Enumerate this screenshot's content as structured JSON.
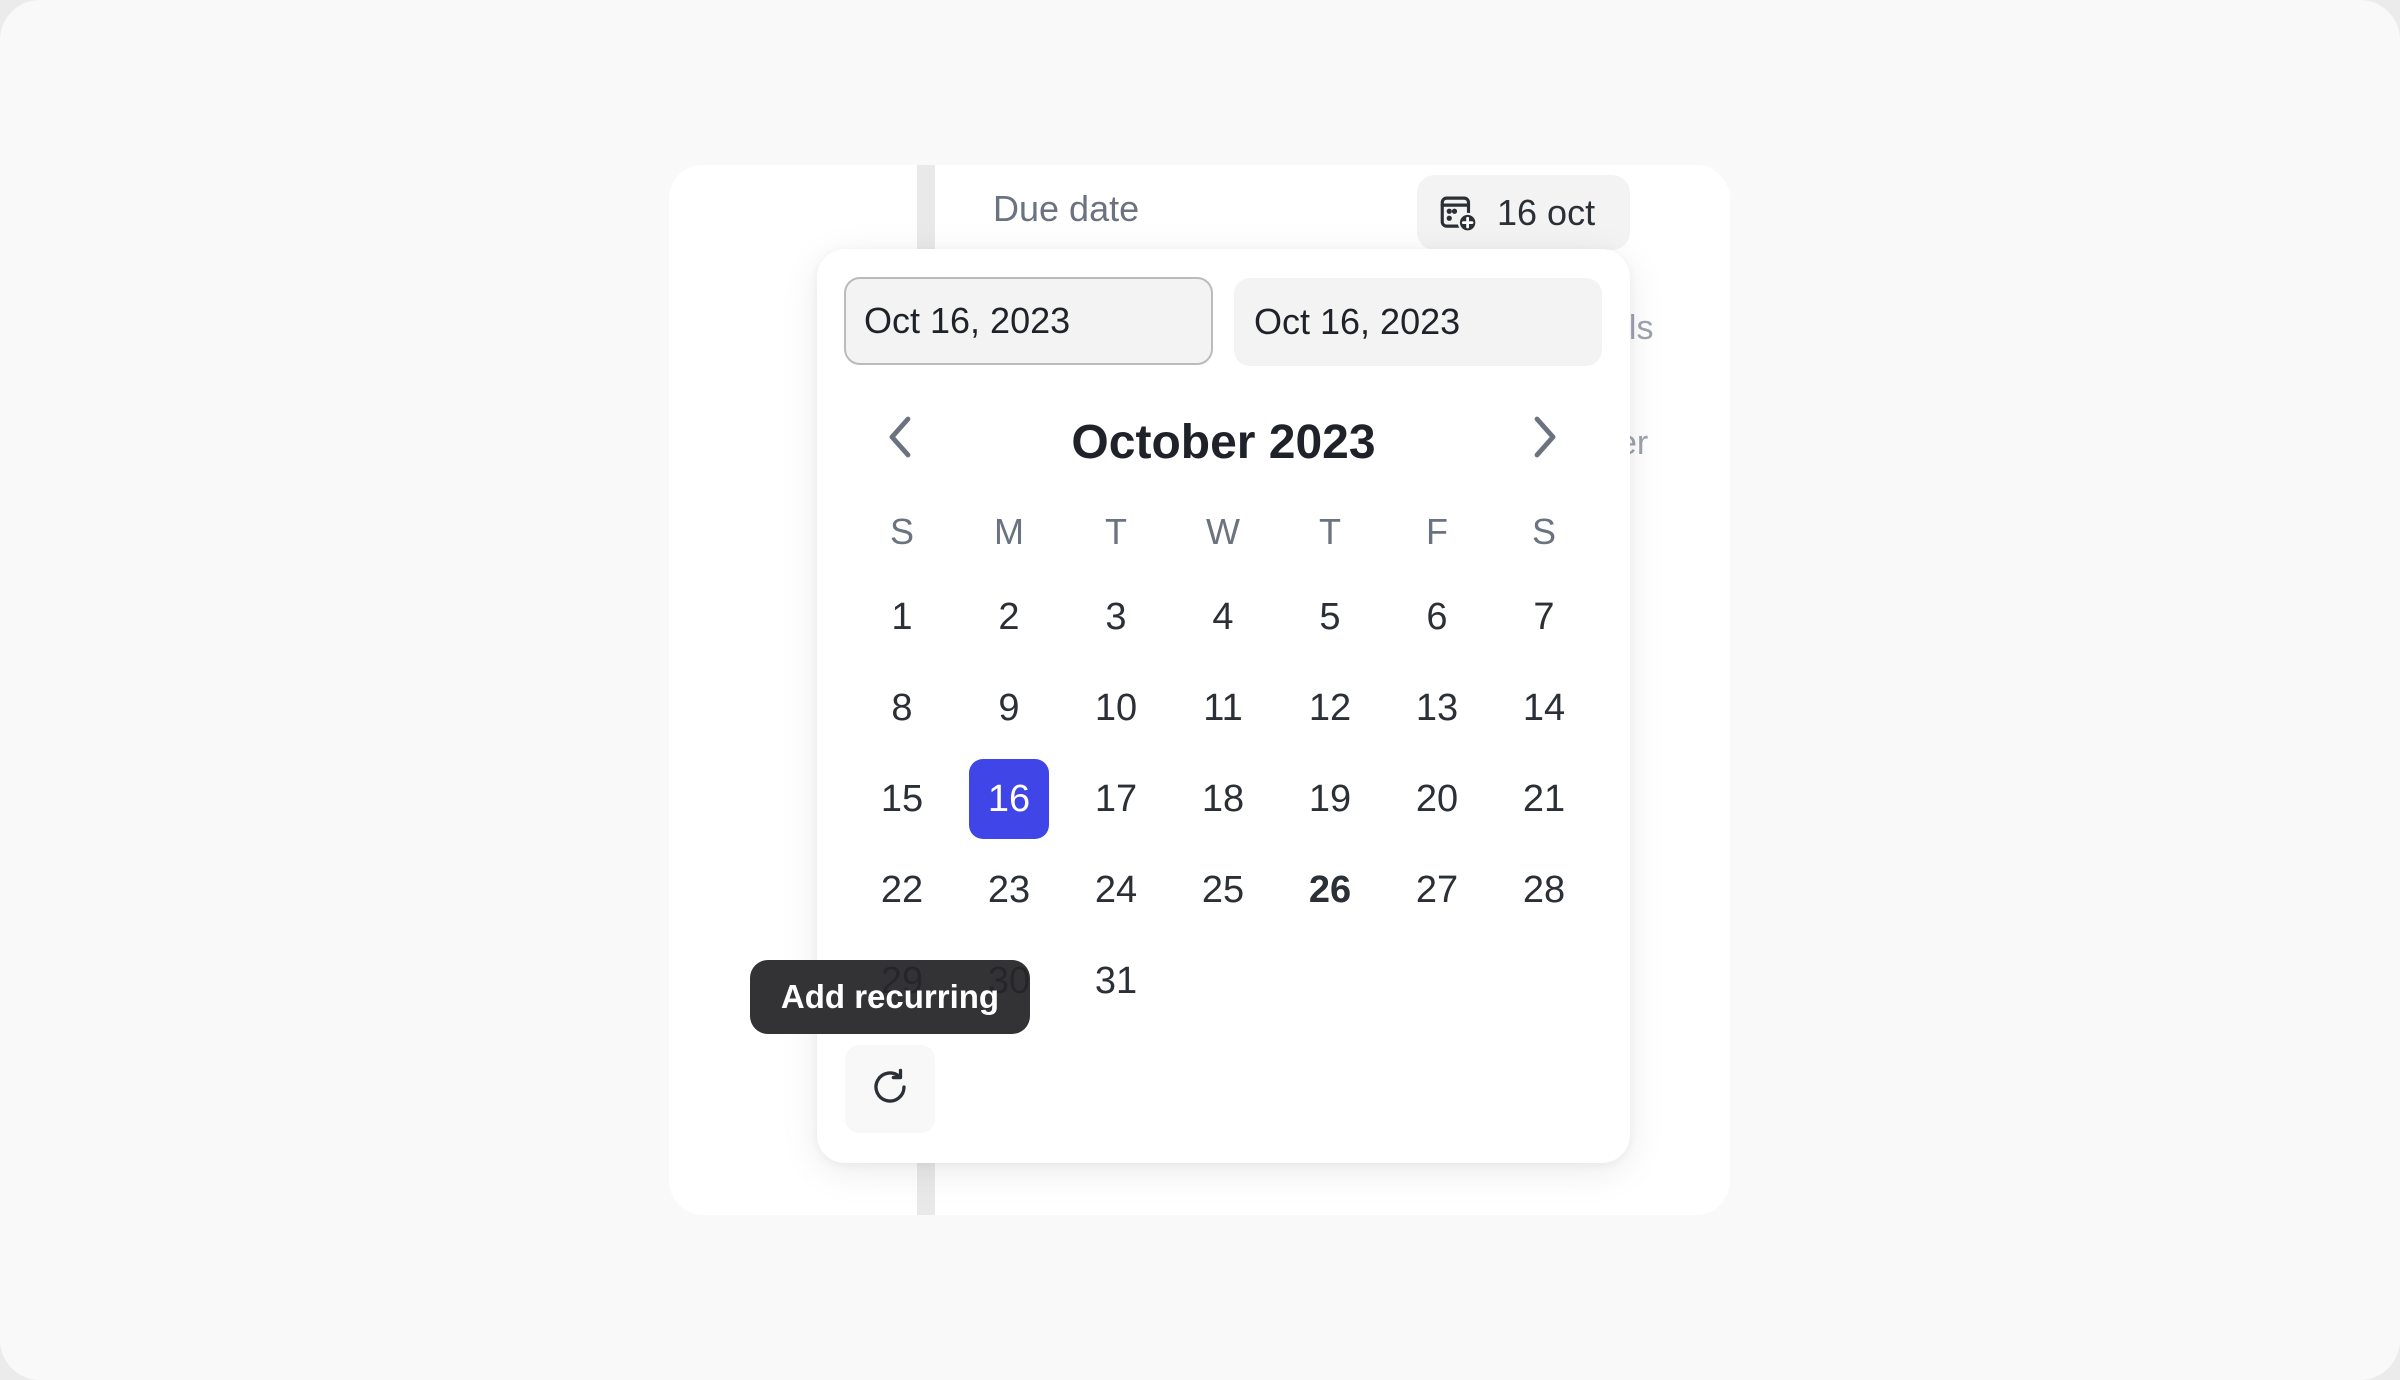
{
  "task_panel": {
    "due_date_label": "Due date",
    "due_date_chip": {
      "icon": "calendar-plus-icon",
      "value": "16 oct"
    },
    "hidden_labels": [
      "els",
      "er"
    ]
  },
  "date_picker": {
    "start_input": {
      "value": "Oct 16, 2023",
      "active": true
    },
    "end_input": {
      "value": "Oct 16, 2023",
      "active": false
    },
    "month_title": "October 2023",
    "prev_icon": "chevron-left-icon",
    "next_icon": "chevron-right-icon",
    "weekdays": [
      "S",
      "M",
      "T",
      "W",
      "T",
      "F",
      "S"
    ],
    "first_weekday_index": 0,
    "days_in_month": 31,
    "selected_day": 16,
    "today_day": 26,
    "selected_color": "#4045E8",
    "recurring_button": {
      "icon": "repeat-icon",
      "tooltip": "Add recurring"
    }
  }
}
